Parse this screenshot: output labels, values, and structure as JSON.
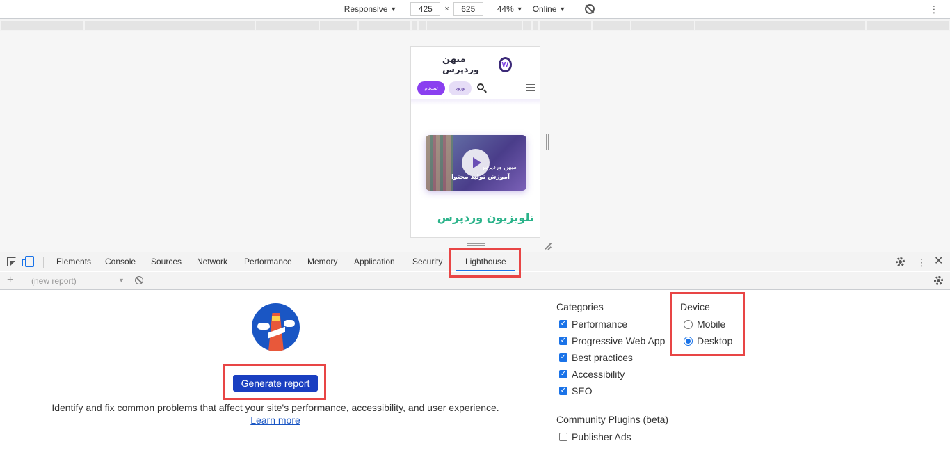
{
  "device_toolbar": {
    "mode": "Responsive",
    "width": "425",
    "height": "625",
    "zoom": "44%",
    "throttle": "Online",
    "separator": "×"
  },
  "phone": {
    "logo_text": "میهن وردپرس",
    "signup_label": "ثبت‌نام",
    "login_label": "ورود",
    "video_line1": "میهن وردپرس",
    "video_line2": "آموزش تولید محتوا",
    "title": "تلویزیون وردپرس"
  },
  "devtools": {
    "tabs": [
      "Elements",
      "Console",
      "Sources",
      "Network",
      "Performance",
      "Memory",
      "Application",
      "Security",
      "Lighthouse"
    ],
    "active_tab": "Lighthouse",
    "report_placeholder": "(new report)"
  },
  "lighthouse": {
    "generate_label": "Generate report",
    "description": "Identify and fix common problems that affect your site's performance, accessibility, and user experience.",
    "learn_more": "Learn more",
    "categories_title": "Categories",
    "categories": [
      {
        "label": "Performance",
        "checked": true
      },
      {
        "label": "Progressive Web App",
        "checked": true
      },
      {
        "label": "Best practices",
        "checked": true
      },
      {
        "label": "Accessibility",
        "checked": true
      },
      {
        "label": "SEO",
        "checked": true
      }
    ],
    "plugins_title": "Community Plugins (beta)",
    "plugins": [
      {
        "label": "Publisher Ads",
        "checked": false
      }
    ],
    "device_title": "Device",
    "devices": [
      {
        "label": "Mobile",
        "selected": false
      },
      {
        "label": "Desktop",
        "selected": true
      }
    ]
  },
  "colors": {
    "accent": "#1a73e8",
    "button": "#1a3fc1",
    "highlight": "#e84545"
  }
}
